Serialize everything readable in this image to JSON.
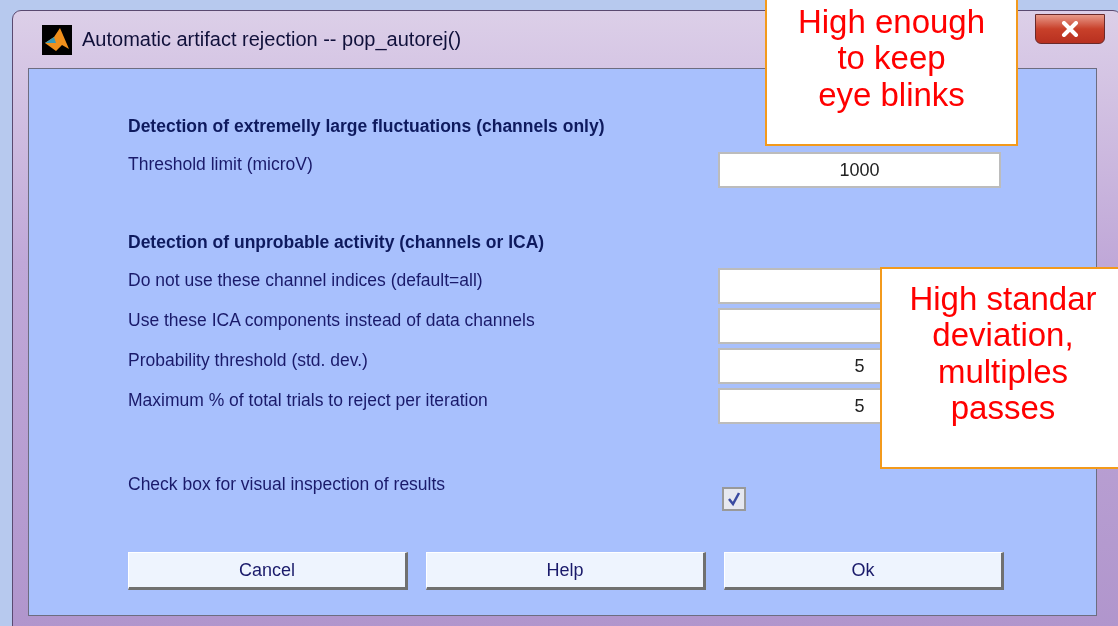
{
  "window": {
    "title": "Automatic artifact rejection -- pop_autorej()"
  },
  "sections": [
    {
      "heading": "Detection of extremelly large fluctuations (channels only)",
      "rows": [
        {
          "kind": "field",
          "label": "Threshold limit (microV)",
          "value": "1000"
        }
      ]
    },
    {
      "heading": "Detection of unprobable activity (channels or ICA)",
      "rows": [
        {
          "kind": "field",
          "label": "Do not use these channel indices (default=all)"
        },
        {
          "kind": "field",
          "label": "Use these ICA components instead of data channels"
        },
        {
          "kind": "field",
          "label": "Probability threshold (std. dev.)",
          "value": "5"
        },
        {
          "kind": "field",
          "label": "Maximum % of total trials to reject per iteration",
          "value": "5"
        }
      ]
    },
    {
      "rows": [
        {
          "kind": "checkbox",
          "label": "Check box for visual inspection of results",
          "checked": true
        }
      ]
    }
  ],
  "buttons": [
    "Cancel",
    "Help",
    "Ok"
  ],
  "callouts": [
    {
      "text": "High enough\nto keep\neye blinks"
    },
    {
      "text": "High standar\ndeviation,\nmultiples\npasses"
    }
  ]
}
